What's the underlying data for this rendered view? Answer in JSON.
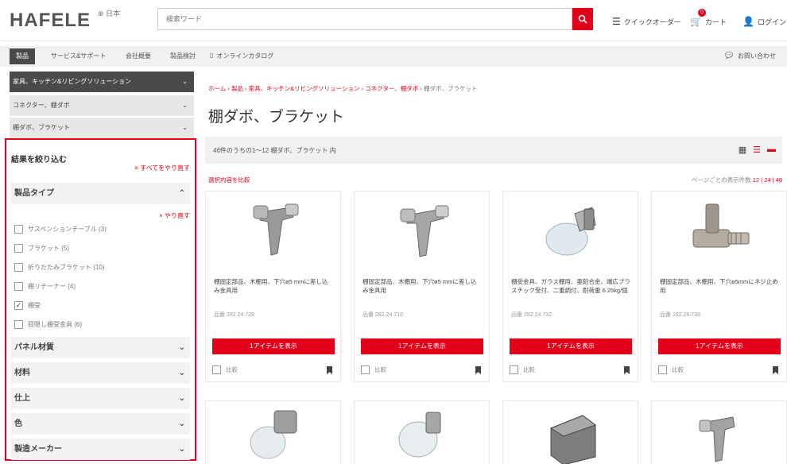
{
  "header": {
    "brand": "HAFELE",
    "region": "⊕ 日本",
    "search_placeholder": "検索ワード",
    "quick_order": "クイックオーダー",
    "cart": "カート",
    "cart_count": "0",
    "login": "ログイン"
  },
  "nav": {
    "active": "製品",
    "items": [
      "サービス&サポート",
      "会社概要",
      "製品検討",
      "オンラインカタログ"
    ],
    "contact": "お問い合わせ"
  },
  "categories": [
    "家具、キッチン&リビングソリューション",
    "コネクター、棚ダボ",
    "棚ダボ、ブラケット"
  ],
  "filter": {
    "title": "結果を絞り込む",
    "clear_all": "× すべてをやり直す",
    "product_type": "製品タイプ",
    "undo": "× やり直す",
    "options": [
      {
        "label": "サスペンションテーブル (3)",
        "checked": false
      },
      {
        "label": "ブラケット (5)",
        "checked": false
      },
      {
        "label": "折りたたみブラケット (10)",
        "checked": false
      },
      {
        "label": "棚リテーナー (4)",
        "checked": false
      },
      {
        "label": "棚受",
        "checked": true
      },
      {
        "label": "目隠し棚受金具 (6)",
        "checked": false
      }
    ],
    "sections": [
      "パネル材質",
      "材料",
      "仕上",
      "色",
      "製造メーカー"
    ]
  },
  "main": {
    "breadcrumb": [
      "ホーム",
      "製品",
      "家具、キッチン&リビングソリューション",
      "コネクター、棚ダボ"
    ],
    "breadcrumb_current": "棚ダボ、ブラケット",
    "title": "棚ダボ、ブラケット",
    "result_text": "46件のうちの1～12 棚ダボ、ブラケット 内",
    "compare_link": "選択内容を比較",
    "per_page_label": "ページごとの表示件数",
    "per_page_opts": "12 | 24 | 48"
  },
  "products": [
    {
      "desc": "棚固定部品、木棚用、下穴ø5 mmに差し込み金具用",
      "num": "品番 282.24.728",
      "button": "1アイテムを表示",
      "compare": "比較"
    },
    {
      "desc": "棚固定部品、木棚用、下穴ø5 mmに差し込み金具用",
      "num": "品番 282.24.710",
      "button": "1アイテムを表示",
      "compare": "比較"
    },
    {
      "desc": "棚受金具、ガラス棚用、亜鉛合金、端広プラスチック受付、二重調付、耐荷重 6.25kg/個",
      "num": "品番 282.24.732",
      "button": "1アイテムを表示",
      "compare": "比較"
    },
    {
      "desc": "棚固定部品、木棚用、下穴ø5mmにネジ止め用",
      "num": "品番 282.26.738",
      "button": "1アイテムを表示",
      "compare": "比較"
    }
  ],
  "colors": {
    "accent": "#e2001a",
    "dark": "#4a4a4a"
  }
}
